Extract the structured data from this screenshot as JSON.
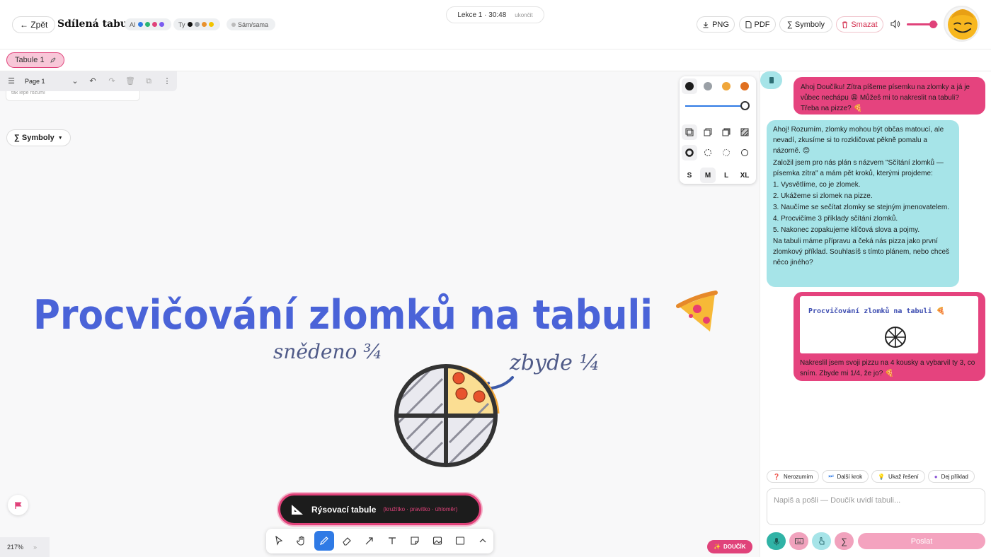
{
  "header": {
    "back_label": "← Zpět",
    "title": "Sdílená tabule",
    "ai_label": "AI",
    "ai_colors": [
      "#2f7ae5",
      "#2bb673",
      "#e0427a",
      "#7a5cf0"
    ],
    "you_label": "Ty",
    "you_colors": [
      "#111111",
      "#9aa0a6",
      "#e8912d",
      "#f2c400"
    ],
    "mode_label": "Sám/sama",
    "session_label": "Lekce 1 · 30:48",
    "session_end": "ukončit",
    "png_label": "PNG",
    "pdf_label": "PDF",
    "symbols_label": "∑ Symboly",
    "delete_label": "Smazat",
    "volume_level": 0.85
  },
  "tabs": [
    {
      "label": "Tabule 1"
    }
  ],
  "canvas": {
    "page_label": "Page 1",
    "hidden_note": "tak lépe rozumí",
    "symbols_label": "∑ Symboly",
    "zoom": "217%",
    "drafting_label": "Rýsovací tabule",
    "drafting_sub": "(kružítko · pravítko · úhloměr)",
    "doucik_badge": "DOUČÍK",
    "style_panel": {
      "colors": [
        "#1c1c1c",
        "#9aa0a6",
        "#f0a63a",
        "#e07020"
      ],
      "sizes": [
        "S",
        "M",
        "L",
        "XL"
      ],
      "selected_size": "M",
      "opacity": 1.0
    },
    "drawing": {
      "title": "Procvičování zlomků na tabuli",
      "eaten_label": "snědeno ¾",
      "left_label": "zbyde ¼",
      "title_color": "#4a63d8"
    }
  },
  "chat": {
    "messages": [
      {
        "role": "user",
        "text": "Ahoj Doučíku! Zítra píšeme písemku na zlomky a já je vůbec nechápu 😩 Můžeš mi to nakreslit na tabuli? Třeba na pizze? 🍕"
      },
      {
        "role": "ai",
        "intro": "Ahoj! Rozumím, zlomky mohou být občas matoucí, ale nevadí, zkusíme si to rozkličovat pěkně pomalu a názorně. 😊",
        "plan": "Založil jsem pro nás plán s názvem \"Sčítání zlomků — písemka zítra\" a mám pět kroků, kterými projdeme:",
        "steps": [
          "1. Vysvětlíme, co je zlomek.",
          "2. Ukážeme si zlomek na pizze.",
          "3. Naučíme se sečítat zlomky se stejným jmenovatelem.",
          "4. Procvičíme 3 příklady sčítání zlomků.",
          "5. Nakonec zopakujeme klíčová slova a pojmy."
        ],
        "outro": "Na tabuli máme přípravu a čeká nás pizza jako první zlomkový příklad. Souhlasíš s tímto plánem, nebo chceš něco jiného?"
      },
      {
        "role": "user",
        "card_title": "Procvičování zlomků na tabuli 🍕",
        "text": "Nakreslil jsem svoji pizzu na 4 kousky a vybarvil ty 3, co sním. Zbyde mi 1/4, že jo? 🍕"
      }
    ],
    "quick_replies": [
      "Nerozumím",
      "Další krok",
      "Ukaž řešení",
      "Dej příklad"
    ],
    "input_placeholder": "Napiš a pošli — Doučík uvidí tabuli...",
    "send_label": "Poslat",
    "colors": {
      "user": "#e5437e",
      "ai": "#a6e4e8",
      "accent": "#e0427a"
    }
  }
}
